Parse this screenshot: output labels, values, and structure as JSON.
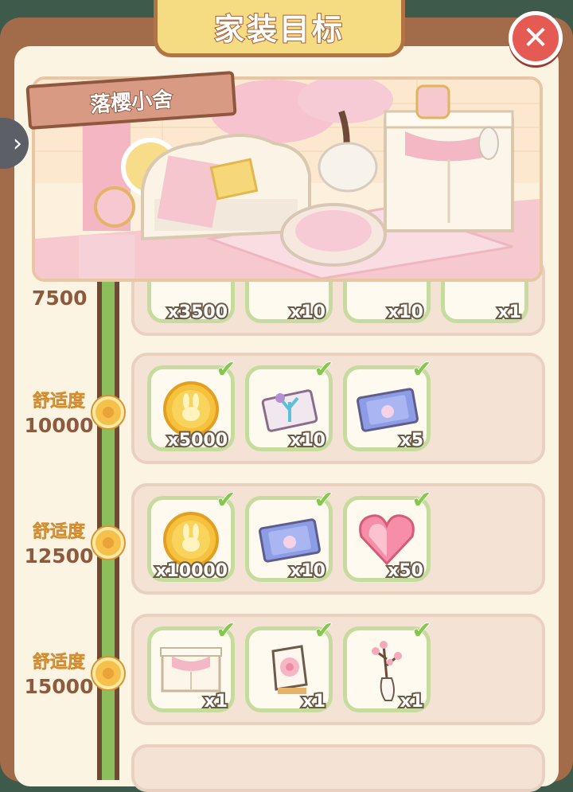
{
  "header": {
    "title": "家装目标",
    "close_icon": "close-icon"
  },
  "room": {
    "name": "落樱小舍"
  },
  "nav": {
    "side_arrow": "›"
  },
  "tiers": [
    {
      "label": "",
      "value": "7500",
      "rewards": [
        {
          "icon": "coin",
          "count": "x3500"
        },
        {
          "icon": "item",
          "count": "x10"
        },
        {
          "icon": "item",
          "count": "x10"
        },
        {
          "icon": "item",
          "count": "x1"
        }
      ]
    },
    {
      "label": "舒适度",
      "value": "10000",
      "rewards": [
        {
          "icon": "bunny-coin",
          "count": "x5000",
          "claimed": true
        },
        {
          "icon": "coral-ticket",
          "count": "x10",
          "claimed": true
        },
        {
          "icon": "bunny-ticket",
          "count": "x5",
          "claimed": true
        }
      ]
    },
    {
      "label": "舒适度",
      "value": "12500",
      "rewards": [
        {
          "icon": "bunny-coin",
          "count": "x10000",
          "claimed": true
        },
        {
          "icon": "bunny-ticket",
          "count": "x10",
          "claimed": true
        },
        {
          "icon": "heart-gem",
          "count": "x50",
          "claimed": true
        }
      ]
    },
    {
      "label": "舒适度",
      "value": "15000",
      "rewards": [
        {
          "icon": "cabinet",
          "count": "x1",
          "claimed": true
        },
        {
          "icon": "sakura-frame",
          "count": "x1",
          "claimed": true
        },
        {
          "icon": "blossom-vase",
          "count": "x1",
          "claimed": true
        }
      ]
    }
  ],
  "colors": {
    "accent": "#f5c14a",
    "check": "#86c84e",
    "close": "#e55a52",
    "track": "#8cbf5c"
  }
}
